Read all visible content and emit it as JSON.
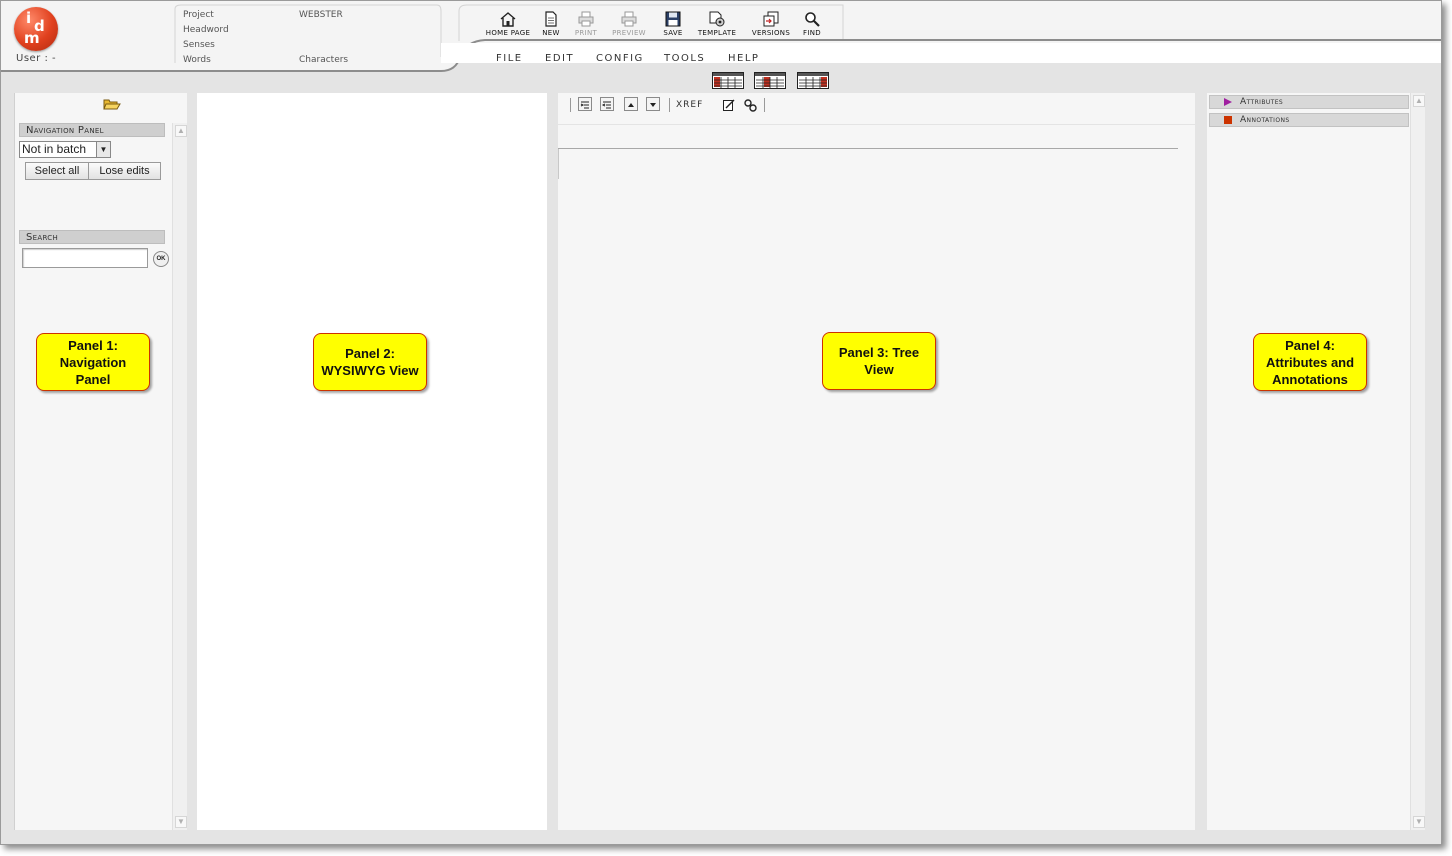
{
  "header": {
    "user_label": "User : -",
    "info": {
      "project_label": "Project",
      "project_value": "WEBSTER",
      "headword_label": "Headword",
      "senses_label": "Senses",
      "words_label": "Words",
      "characters_label": "Characters"
    },
    "toolbar": [
      {
        "label": "HOME PAGE",
        "icon": "home-icon",
        "enabled": true
      },
      {
        "label": "NEW",
        "icon": "new-document-icon",
        "enabled": true
      },
      {
        "label": "PRINT",
        "icon": "printer-icon",
        "enabled": false
      },
      {
        "label": "PREVIEW",
        "icon": "print-preview-icon",
        "enabled": false
      },
      {
        "label": "SAVE",
        "icon": "floppy-disk-icon",
        "enabled": true
      },
      {
        "label": "TEMPLATE",
        "icon": "template-gear-icon",
        "enabled": true
      },
      {
        "label": "VERSIONS",
        "icon": "versions-icon",
        "enabled": true
      },
      {
        "label": "FIND",
        "icon": "magnifier-icon",
        "enabled": true
      }
    ],
    "menu": [
      "FILE",
      "EDIT",
      "CONFIG",
      "TOOLS",
      "HELP"
    ],
    "layout_icons": [
      "layout-1-icon",
      "layout-2-icon",
      "layout-3-icon"
    ]
  },
  "panel1": {
    "navigation_title": "Navigation Panel",
    "batch_select_value": "Not in batch",
    "select_all_label": "Select all",
    "lose_edits_label": "Lose edits",
    "search_title": "Search",
    "search_value": "",
    "ok_label": "OK"
  },
  "panel3": {
    "xref_label": "XREF"
  },
  "panel4": {
    "attributes_label": "Attributes",
    "annotations_label": "Annotations"
  },
  "callouts": {
    "panel1": "Panel 1:\nNavigation\nPanel",
    "panel2": "Panel 2:\nWYSIWYG View",
    "panel3": "Panel 3: Tree\nView",
    "panel4": "Panel 4:\nAttributes and\nAnnotations"
  },
  "colors": {
    "callout_fill": "#ffff00",
    "callout_border": "#cc3300",
    "logo": "#e0401e",
    "attributes_marker": "#a020a0",
    "annotations_marker": "#cc3300"
  }
}
